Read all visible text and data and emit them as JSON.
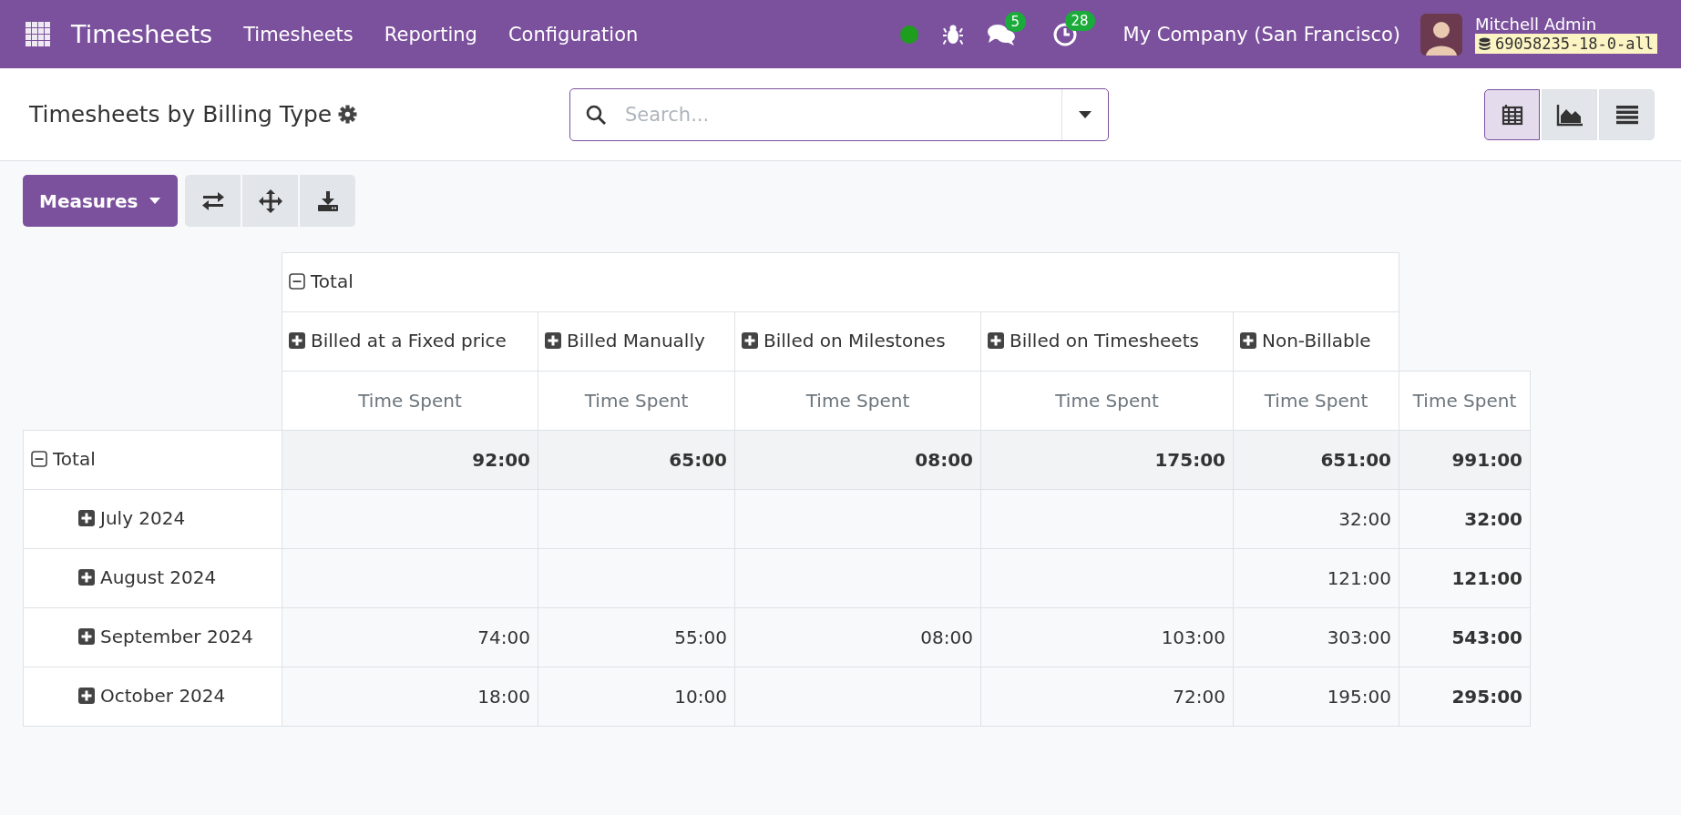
{
  "navbar": {
    "app_name": "Timesheets",
    "menu": [
      "Timesheets",
      "Reporting",
      "Configuration"
    ],
    "messages_count": "5",
    "activities_count": "28",
    "company": "My Company (San Francisco)",
    "user_name": "Mitchell Admin",
    "database": "69058235-18-0-all"
  },
  "control_panel": {
    "title": "Timesheets by Billing Type",
    "search": {
      "placeholder": "Search..."
    },
    "views": [
      {
        "kind": "pivot",
        "selected": true
      },
      {
        "kind": "graph",
        "selected": false
      },
      {
        "kind": "list",
        "selected": false
      }
    ]
  },
  "toolbar": {
    "measures_label": "Measures"
  },
  "pivot": {
    "column_total": {
      "label": "Total",
      "expanded": true
    },
    "column_groups": [
      {
        "label": "Billed at a Fixed price",
        "expanded": false
      },
      {
        "label": "Billed Manually",
        "expanded": false
      },
      {
        "label": "Billed on Milestones",
        "expanded": false
      },
      {
        "label": "Billed on Timesheets",
        "expanded": false
      },
      {
        "label": "Non-Billable",
        "expanded": false
      }
    ],
    "measures": [
      "Time Spent",
      "Time Spent",
      "Time Spent",
      "Time Spent",
      "Time Spent",
      "Time Spent"
    ],
    "row_total": {
      "label": "Total",
      "expanded": true,
      "values": {
        "fixed_price": "92:00",
        "manually": "65:00",
        "milestones": "08:00",
        "timesheets": "175:00",
        "non_billable": "651:00",
        "total": "991:00"
      }
    },
    "rows": [
      {
        "label": "July 2024",
        "expanded": false,
        "values": {
          "non_billable": "32:00",
          "total": "32:00"
        }
      },
      {
        "label": "August 2024",
        "expanded": false,
        "values": {
          "non_billable": "121:00",
          "total": "121:00"
        }
      },
      {
        "label": "September 2024",
        "expanded": false,
        "values": {
          "fixed_price": "74:00",
          "manually": "55:00",
          "milestones": "08:00",
          "timesheets": "103:00",
          "non_billable": "303:00",
          "total": "543:00"
        }
      },
      {
        "label": "October 2024",
        "expanded": false,
        "values": {
          "fixed_price": "18:00",
          "manually": "10:00",
          "timesheets": "72:00",
          "non_billable": "195:00",
          "total": "295:00"
        }
      }
    ]
  }
}
